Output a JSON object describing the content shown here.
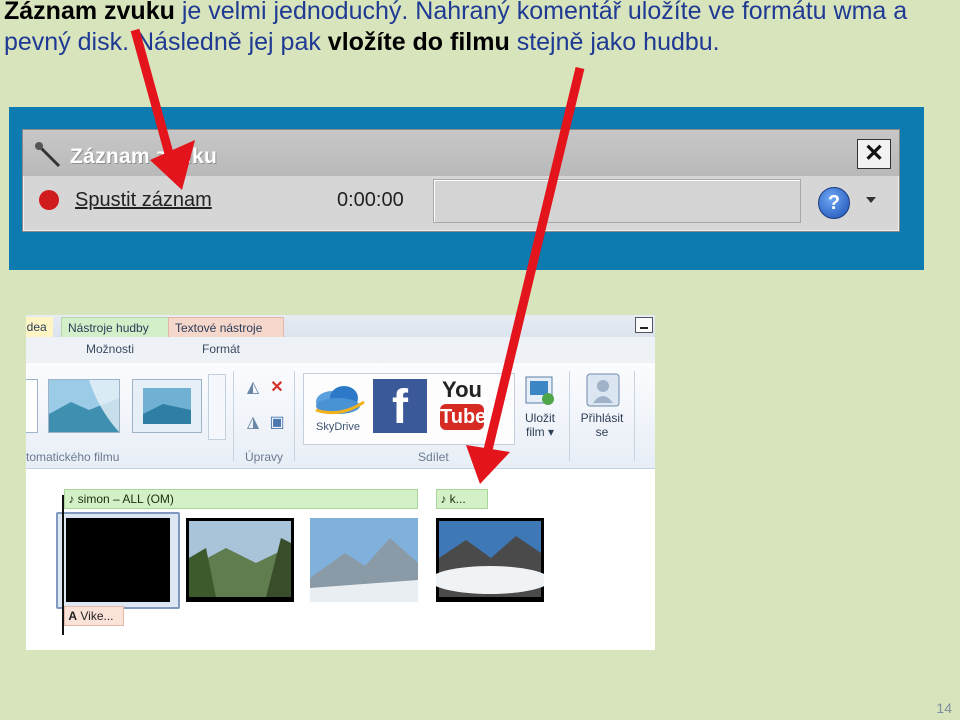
{
  "caption": {
    "part1": "Záznam zvuku",
    "part2": " je velmi jednoduchý. Nahraný komentář uložíte ve formátu wma a pevný disk. Následně jej pak ",
    "part3": "vložíte do filmu",
    "part4": " stejně jako hudbu."
  },
  "recorder": {
    "title": "Záznam zvuku",
    "start_label": "Spustit záznam",
    "time": "0:00:00",
    "help": "?",
    "close": "✕"
  },
  "moviemaker": {
    "tabs": {
      "video": "idea",
      "music": "Nástroje hudby",
      "text": "Textové nástroje"
    },
    "subtabs": {
      "options": "Možnosti",
      "format": "Formát"
    },
    "groups": {
      "themes": "tomatického filmu",
      "edit": "Úpravy",
      "share": "Sdílet"
    },
    "share": {
      "skydrive": "SkyDrive",
      "youtube_you": "You",
      "youtube_tube": "Tube"
    },
    "buttons": {
      "save_movie": "Uložit film",
      "save_movie_line1": "Uložit",
      "save_movie_line2": "film",
      "sign_in_line1": "Přihlásit",
      "sign_in_line2": "se"
    },
    "timeline": {
      "music1": "simon – ALL (OM)",
      "music2": "k...",
      "text_tag": "Vike..."
    }
  },
  "page_number": "14",
  "colors": {
    "accent_blue": "#0e7bb0",
    "arrow_red": "#e3141b",
    "background": "#d8e4bc"
  }
}
